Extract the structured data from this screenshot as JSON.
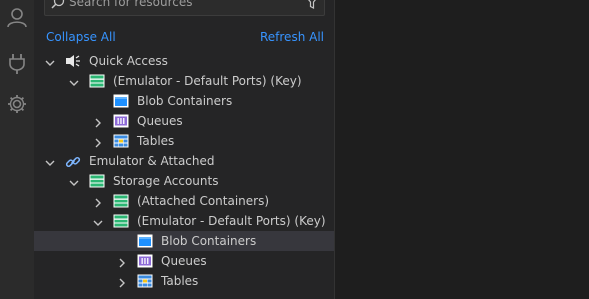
{
  "search": {
    "placeholder": "Search for resources"
  },
  "actions": {
    "collapse_all": "Collapse All",
    "refresh_all": "Refresh All"
  },
  "tree": [
    {
      "name": "tree-item-quick-access",
      "label": "Quick Access",
      "level": 0,
      "chevron": "down",
      "icon": "quick-access-icon"
    },
    {
      "name": "tree-item-emulator-default-ports-key",
      "label": "(Emulator - Default Ports) (Key)",
      "level": 1,
      "chevron": "down",
      "icon": "storage-account-icon"
    },
    {
      "name": "tree-item-blob-containers",
      "label": "Blob Containers",
      "level": 2,
      "chevron": "none",
      "icon": "blob-containers-icon"
    },
    {
      "name": "tree-item-queues",
      "label": "Queues",
      "level": 2,
      "chevron": "right",
      "icon": "queues-icon"
    },
    {
      "name": "tree-item-tables",
      "label": "Tables",
      "level": 2,
      "chevron": "right",
      "icon": "tables-icon"
    },
    {
      "name": "tree-item-emulator-attached",
      "label": "Emulator & Attached",
      "level": 0,
      "chevron": "down",
      "icon": "link-icon"
    },
    {
      "name": "tree-item-storage-accounts",
      "label": "Storage Accounts",
      "level": 1,
      "chevron": "down",
      "icon": "storage-account-icon"
    },
    {
      "name": "tree-item-attached-containers",
      "label": "(Attached Containers)",
      "level": 2,
      "chevron": "right",
      "icon": "storage-account-icon"
    },
    {
      "name": "tree-item-emulator-default-ports-key-2",
      "label": "(Emulator - Default Ports) (Key)",
      "level": 2,
      "chevron": "down",
      "icon": "storage-account-icon"
    },
    {
      "name": "tree-item-blob-containers-2",
      "label": "Blob Containers",
      "level": 3,
      "chevron": "none",
      "icon": "blob-containers-icon",
      "selected": true
    },
    {
      "name": "tree-item-queues-2",
      "label": "Queues",
      "level": 3,
      "chevron": "right",
      "icon": "queues-icon"
    },
    {
      "name": "tree-item-tables-2",
      "label": "Tables",
      "level": 3,
      "chevron": "right",
      "icon": "tables-icon"
    }
  ],
  "colors": {
    "accent_link": "#3794ff",
    "sidebar_bg": "#252526",
    "selected_row": "#37373d",
    "storage_green": "#2bb673",
    "blob_blue": "#1e90ff",
    "queue_purple": "#8e6bd8",
    "table_blue": "#3a8be0"
  }
}
